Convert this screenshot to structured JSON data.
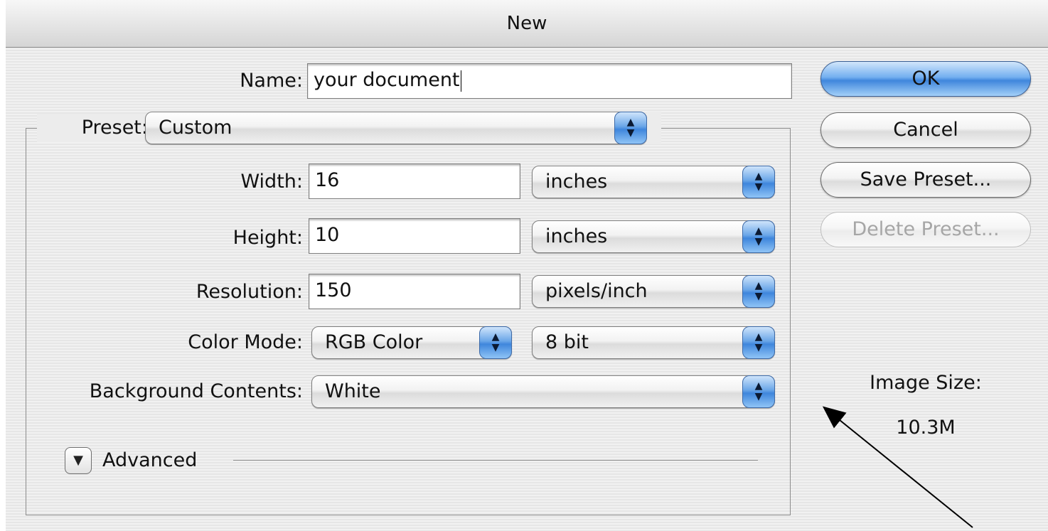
{
  "window": {
    "title": "New"
  },
  "form": {
    "name_label": "Name:",
    "name_value": "your document",
    "preset_label": "Preset:",
    "preset_value": "Custom",
    "width_label": "Width:",
    "width_value": "16",
    "width_unit": "inches",
    "height_label": "Height:",
    "height_value": "10",
    "height_unit": "inches",
    "resolution_label": "Resolution:",
    "resolution_value": "150",
    "resolution_unit": "pixels/inch",
    "color_mode_label": "Color Mode:",
    "color_mode_value": "RGB Color",
    "bit_depth_value": "8 bit",
    "background_label": "Background Contents:",
    "background_value": "White",
    "advanced_label": "Advanced"
  },
  "buttons": {
    "ok": "OK",
    "cancel": "Cancel",
    "save_preset": "Save Preset...",
    "delete_preset": "Delete Preset..."
  },
  "info": {
    "image_size_label": "Image Size:",
    "image_size_value": "10.3M"
  },
  "icons": {
    "stepper": "up-down-arrows-icon",
    "disclosure": "disclosure-triangle-down-icon",
    "annotation": "annotation-arrow"
  },
  "colors": {
    "accent": "#4a8fe0",
    "window_bg": "#ececec"
  }
}
